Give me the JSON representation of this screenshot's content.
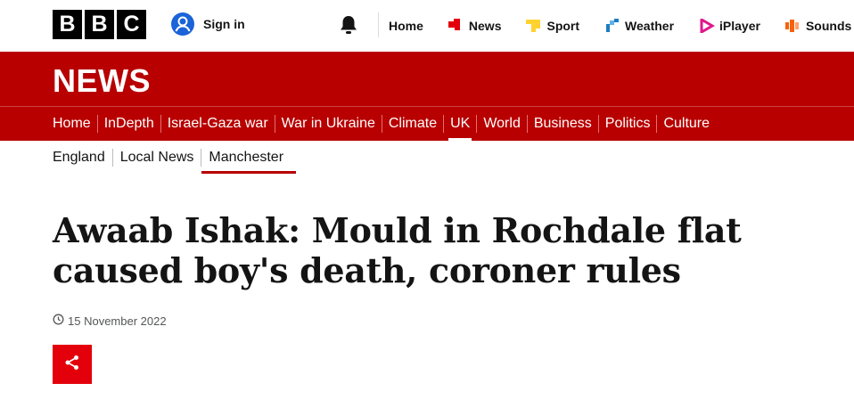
{
  "header": {
    "logo_letters": [
      "B",
      "B",
      "C"
    ],
    "signin_label": "Sign in",
    "top_nav": [
      {
        "label": "Home",
        "icon": "none"
      },
      {
        "label": "News",
        "icon": "news-icon",
        "color": "#e3000b"
      },
      {
        "label": "Sport",
        "icon": "sport-icon",
        "color": "#ffd230"
      },
      {
        "label": "Weather",
        "icon": "weather-icon",
        "color": "#1b7ec1"
      },
      {
        "label": "iPlayer",
        "icon": "iplayer-icon",
        "color": "#e0188c"
      },
      {
        "label": "Sounds",
        "icon": "sounds-icon",
        "color": "#f6620c"
      }
    ]
  },
  "news": {
    "brand": "NEWS",
    "main_nav": [
      "Home",
      "InDepth",
      "Israel-Gaza war",
      "War in Ukraine",
      "Climate",
      "UK",
      "World",
      "Business",
      "Politics",
      "Culture"
    ],
    "active_main": "UK",
    "sub_nav": [
      "England",
      "Local News",
      "Manchester"
    ],
    "active_sub": "Manchester"
  },
  "article": {
    "headline": "Awaab Ishak: Mould in Rochdale flat caused boy's death, coroner rules",
    "date": "15 November 2022"
  },
  "colors": {
    "brand_red": "#b80000",
    "share_red": "#e3000b"
  }
}
